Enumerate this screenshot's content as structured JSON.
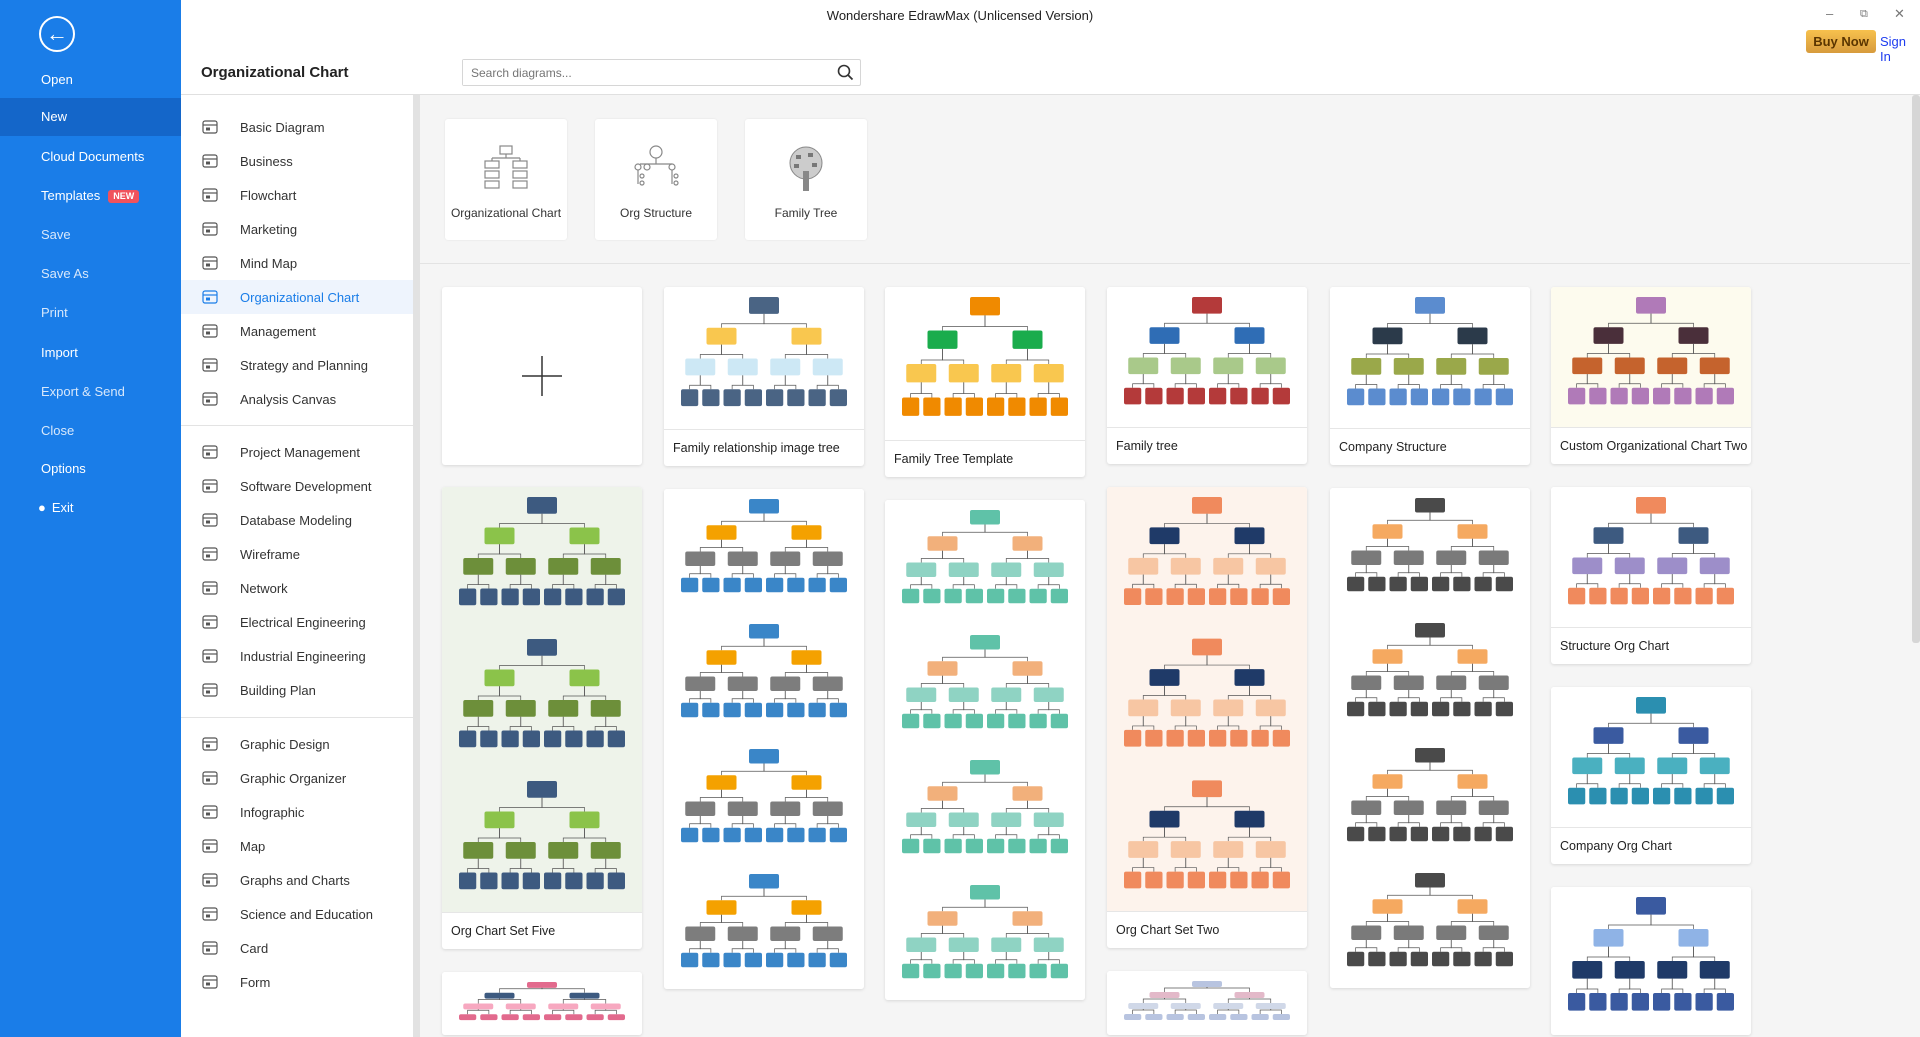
{
  "window": {
    "title": "Wondershare EdrawMax (Unlicensed Version)",
    "buy_now": "Buy Now",
    "sign_in": "Sign In"
  },
  "sidebar": {
    "items": [
      {
        "label": "Open",
        "dim": false
      },
      {
        "label": "New",
        "active": true
      },
      {
        "label": "Cloud Documents"
      },
      {
        "label": "Templates",
        "badge": "NEW"
      },
      {
        "label": "Save",
        "dim": true
      },
      {
        "label": "Save As",
        "dim": true
      },
      {
        "label": "Print",
        "dim": true
      },
      {
        "label": "Import"
      },
      {
        "label": "Export & Send",
        "dim": true
      },
      {
        "label": "Close",
        "dim": true
      },
      {
        "label": "Options"
      },
      {
        "label": "Exit",
        "icon": "minus-circle-icon"
      }
    ]
  },
  "header": {
    "title": "Organizational Chart",
    "search_placeholder": "Search diagrams..."
  },
  "categories": [
    [
      {
        "label": "Basic Diagram",
        "icon": "basic-diagram-icon"
      },
      {
        "label": "Business",
        "icon": "briefcase-icon"
      },
      {
        "label": "Flowchart",
        "icon": "flowchart-icon"
      },
      {
        "label": "Marketing",
        "icon": "bar-chart-icon"
      },
      {
        "label": "Mind Map",
        "icon": "mind-map-icon"
      },
      {
        "label": "Organizational Chart",
        "icon": "org-chart-icon",
        "active": true
      },
      {
        "label": "Management",
        "icon": "management-icon"
      },
      {
        "label": "Strategy and Planning",
        "icon": "strategy-icon"
      },
      {
        "label": "Analysis Canvas",
        "icon": "canvas-icon"
      }
    ],
    [
      {
        "label": "Project Management",
        "icon": "gantt-icon"
      },
      {
        "label": "Software Development",
        "icon": "software-icon"
      },
      {
        "label": "Database Modeling",
        "icon": "database-icon"
      },
      {
        "label": "Wireframe",
        "icon": "wireframe-icon"
      },
      {
        "label": "Network",
        "icon": "network-icon"
      },
      {
        "label": "Electrical Engineering",
        "icon": "electrical-icon"
      },
      {
        "label": "Industrial Engineering",
        "icon": "industrial-icon"
      },
      {
        "label": "Building Plan",
        "icon": "building-plan-icon"
      }
    ],
    [
      {
        "label": "Graphic Design",
        "icon": "graphic-design-icon"
      },
      {
        "label": "Graphic Organizer",
        "icon": "graphic-organizer-icon"
      },
      {
        "label": "Infographic",
        "icon": "infographic-icon"
      },
      {
        "label": "Map",
        "icon": "map-pin-icon"
      },
      {
        "label": "Graphs and Charts",
        "icon": "graphs-icon"
      },
      {
        "label": "Science and Education",
        "icon": "atom-icon"
      },
      {
        "label": "Card",
        "icon": "card-icon"
      },
      {
        "label": "Form",
        "icon": "form-icon"
      }
    ]
  ],
  "type_cards": [
    {
      "label": "Organizational Chart",
      "icon": "org-chart-icon"
    },
    {
      "label": "Org Structure",
      "icon": "org-structure-icon"
    },
    {
      "label": "Family Tree",
      "icon": "family-tree-icon"
    }
  ],
  "templates": [
    [
      {
        "label": "",
        "blank": true,
        "icon": "plus-icon"
      },
      {
        "label": "Org Chart Set Five",
        "bg": "#eef3ea",
        "colors": [
          "#3d5a80",
          "#8bc34a",
          "#6d8f3a"
        ]
      },
      {
        "label": "",
        "bg": "#ffffff",
        "colors": [
          "#e26a8d",
          "#3d5a80",
          "#f7a8c0"
        ]
      }
    ],
    [
      {
        "label": "Family relationship image tree",
        "bg": "#ffffff",
        "colors": [
          "#4a6484",
          "#f9c74f",
          "#cde8f5"
        ]
      },
      {
        "label": "",
        "bg": "#ffffff",
        "colors": [
          "#3a86c8",
          "#f4a100",
          "#7d7d7d"
        ]
      }
    ],
    [
      {
        "label": "Family Tree Template",
        "bg": "#ffffff",
        "colors": [
          "#f08a00",
          "#1aac4c",
          "#f9c74f"
        ]
      },
      {
        "label": "",
        "bg": "#ffffff",
        "colors": [
          "#5fc2a8",
          "#f2b07b",
          "#8fd3c3"
        ]
      }
    ],
    [
      {
        "label": "Family tree",
        "bg": "#ffffff",
        "colors": [
          "#b43a3a",
          "#2f6db5",
          "#a9c98a"
        ]
      },
      {
        "label": "Org Chart Set Two",
        "bg": "#fdf3ec",
        "colors": [
          "#f08a5d",
          "#1f3a68",
          "#f7c6a3"
        ]
      },
      {
        "label": "",
        "bg": "#ffffff",
        "colors": [
          "#b8c4e0",
          "#e3b9c9",
          "#d0d8e8"
        ]
      }
    ],
    [
      {
        "label": "Company Structure",
        "bg": "#ffffff",
        "colors": [
          "#5b8ccf",
          "#2b3a4a",
          "#9aa84a"
        ]
      },
      {
        "label": "",
        "bg": "#ffffff",
        "colors": [
          "#4a4a4a",
          "#f5a960",
          "#7a7a7a"
        ]
      }
    ],
    [
      {
        "label": "Custom Organizational Chart Two",
        "bg": "#fdfbee",
        "colors": [
          "#b07ab8",
          "#4a2f3a",
          "#c5632d"
        ]
      },
      {
        "label": "Structure Org Chart",
        "bg": "#ffffff",
        "colors": [
          "#f08a5d",
          "#3d5a80",
          "#9d8ec9"
        ]
      },
      {
        "label": "Company Org Chart",
        "bg": "#ffffff",
        "colors": [
          "#2b8fb0",
          "#3a5aa0",
          "#4ab0c0"
        ]
      },
      {
        "label": "",
        "bg": "#ffffff",
        "colors": [
          "#3a5aa0",
          "#8fb3e6",
          "#1f3a68"
        ]
      }
    ]
  ],
  "colors": {
    "sidebar": "#1a7de8",
    "sidebar_active": "#1466c9",
    "accent": "#1a7de8",
    "badge": "#f0525c"
  }
}
